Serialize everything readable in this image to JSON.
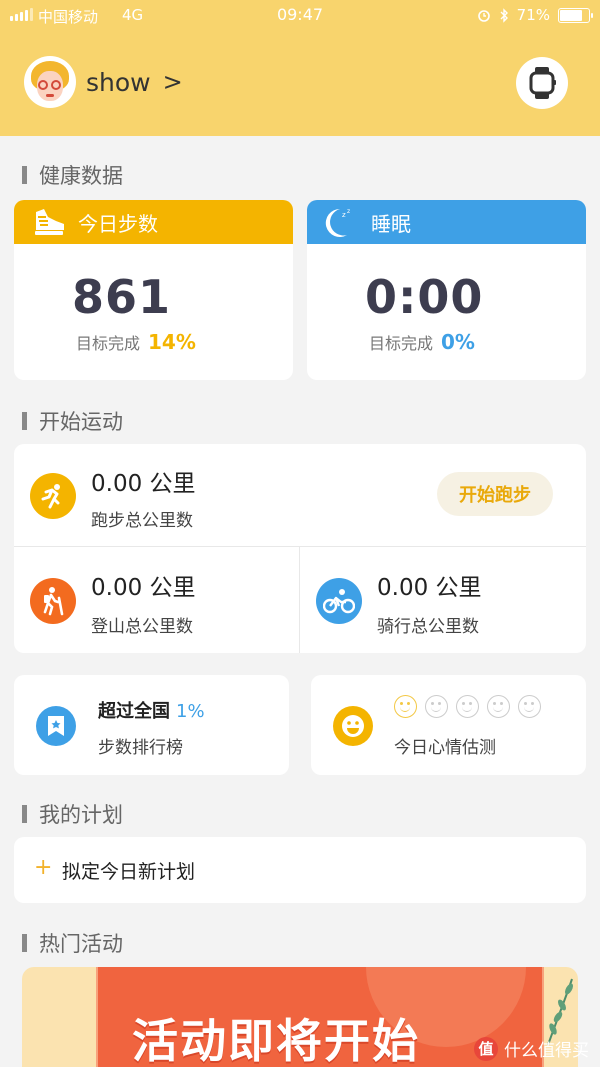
{
  "status_bar": {
    "carrier": "中国移动",
    "network": "4G",
    "time": "09:47",
    "battery": "71%"
  },
  "header": {
    "username": "show",
    "chevron": ">"
  },
  "sections": {
    "health": "健康数据",
    "sport": "开始运动",
    "plan": "我的计划",
    "hot": "热门活动"
  },
  "steps_card": {
    "title": "今日步数",
    "value": "861",
    "goal_label": "目标完成",
    "goal_pct": "14%",
    "color": "#f4b400"
  },
  "sleep_card": {
    "title": "睡眠",
    "value": "0:00",
    "goal_label": "目标完成",
    "goal_pct": "0%",
    "color": "#3ea0e6"
  },
  "sport": {
    "run": {
      "value": "0.00 公里",
      "label": "跑步总公里数",
      "button": "开始跑步"
    },
    "hike": {
      "value": "0.00 公里",
      "label": "登山总公里数"
    },
    "ride": {
      "value": "0.00 公里",
      "label": "骑行总公里数"
    }
  },
  "rank": {
    "title": "超过全国",
    "pct": "1%",
    "label": "步数排行榜"
  },
  "mood": {
    "label": "今日心情估测"
  },
  "plan": {
    "plus": "+",
    "label": "拟定今日新计划"
  },
  "banner": {
    "text": "活动即将开始"
  },
  "watermark": {
    "logo": "值",
    "text": "什么值得买"
  }
}
